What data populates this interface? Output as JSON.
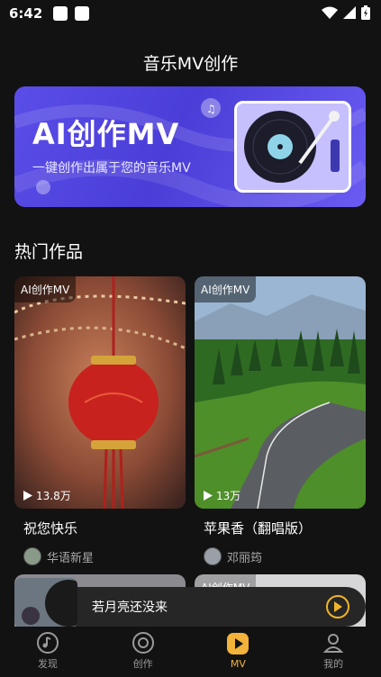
{
  "status": {
    "time": "6:42"
  },
  "header": {
    "title": "音乐MV创作"
  },
  "banner": {
    "title": "AI创作MV",
    "subtitle": "一键创作出属于您的音乐MV"
  },
  "section": {
    "title": "热门作品"
  },
  "cards": [
    {
      "tag": "AI创作MV",
      "plays": "13.8万",
      "title": "祝您快乐",
      "author": "华语新星"
    },
    {
      "tag": "AI创作MV",
      "plays": "13万",
      "title": "苹果香（翻唱版）",
      "author": "邓丽筠"
    }
  ],
  "card_row2": [
    {
      "tag": "AI创作MV"
    }
  ],
  "player": {
    "song": "若月亮还没来"
  },
  "tabs": [
    {
      "label": "发现",
      "icon": "music-note-icon"
    },
    {
      "label": "创作",
      "icon": "create-icon"
    },
    {
      "label": "MV",
      "icon": "mv-play-icon",
      "active": true
    },
    {
      "label": "我的",
      "icon": "profile-icon"
    }
  ],
  "colors": {
    "accent": "#f3b23a",
    "background": "#121212",
    "banner": "#5a4de8"
  }
}
